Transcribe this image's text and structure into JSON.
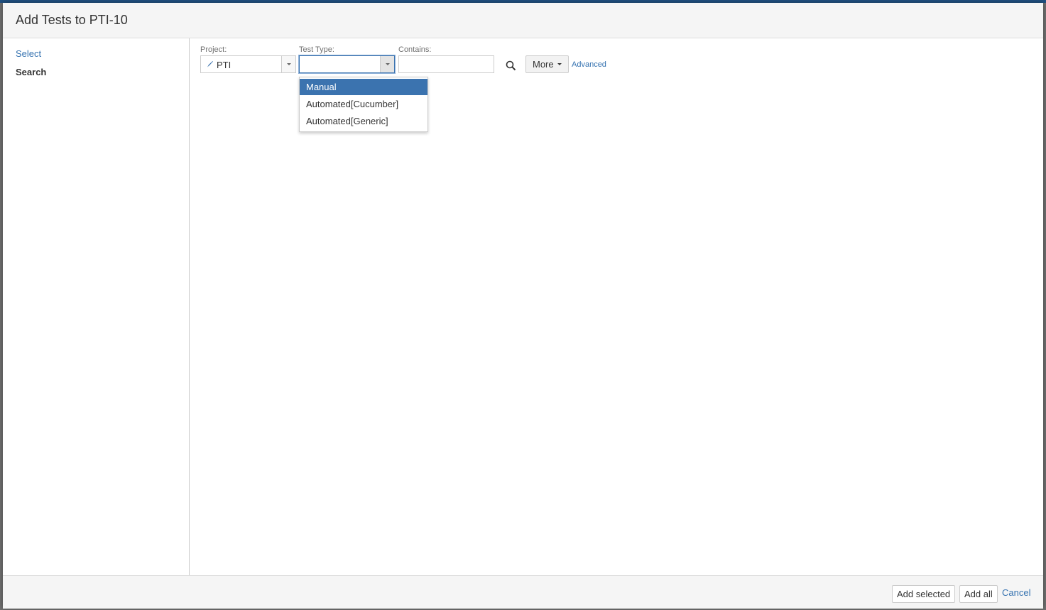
{
  "dialog": {
    "title": "Add Tests to PTI-10"
  },
  "sidebar": {
    "items": [
      {
        "label": "Select"
      },
      {
        "label": "Search"
      }
    ]
  },
  "filters": {
    "project_label": "Project:",
    "project_value": "PTI",
    "test_type_label": "Test Type:",
    "test_type_value": "",
    "contains_label": "Contains:",
    "contains_value": "",
    "more_label": "More",
    "advanced_label": "Advanced"
  },
  "test_type_options": [
    {
      "label": "Manual",
      "highlighted": true
    },
    {
      "label": "Automated[Cucumber]",
      "highlighted": false
    },
    {
      "label": "Automated[Generic]",
      "highlighted": false
    }
  ],
  "footer": {
    "add_selected_label": "Add selected",
    "add_all_label": "Add all",
    "cancel_label": "Cancel"
  },
  "colors": {
    "link": "#3572b0",
    "highlight": "#3b73af"
  }
}
